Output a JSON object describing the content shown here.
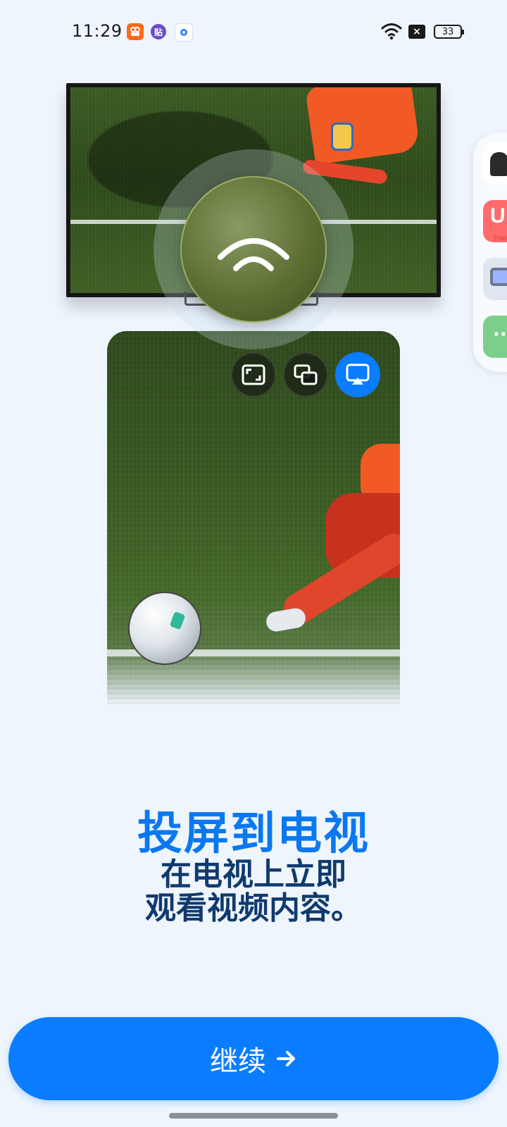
{
  "status_bar": {
    "time": "11:29",
    "notification_icons": [
      "video-app-icon",
      "sticker-app-icon",
      "camera-app-icon"
    ],
    "notification_glyph_b": "贴",
    "wifi": "wifi-icon",
    "no_sim": "×",
    "battery_level": "33"
  },
  "illustration": {
    "tv": "tv-illustration",
    "phone": "phone-illustration",
    "cast_icon": "cast-wifi-icon",
    "controls": [
      {
        "name": "fullscreen-icon"
      },
      {
        "name": "picture-in-picture-icon"
      },
      {
        "name": "screen-cast-icon",
        "active": true
      }
    ]
  },
  "side_panel": {
    "apps": [
      {
        "name": "side-app-contacts"
      },
      {
        "name": "side-app-translate",
        "letter": "U",
        "caption": "Tran"
      },
      {
        "name": "side-app-screen"
      },
      {
        "name": "side-app-more",
        "glyph": "··"
      }
    ]
  },
  "content": {
    "title": "投屏到电视",
    "subtitle_line1": "在电视上立即",
    "subtitle_line2": "观看视频内容。"
  },
  "button": {
    "label": "继续"
  },
  "colors": {
    "accent": "#0a7cff",
    "title": "#0a78f0",
    "subtitle": "#103a6e",
    "background": "#eef5fd"
  }
}
